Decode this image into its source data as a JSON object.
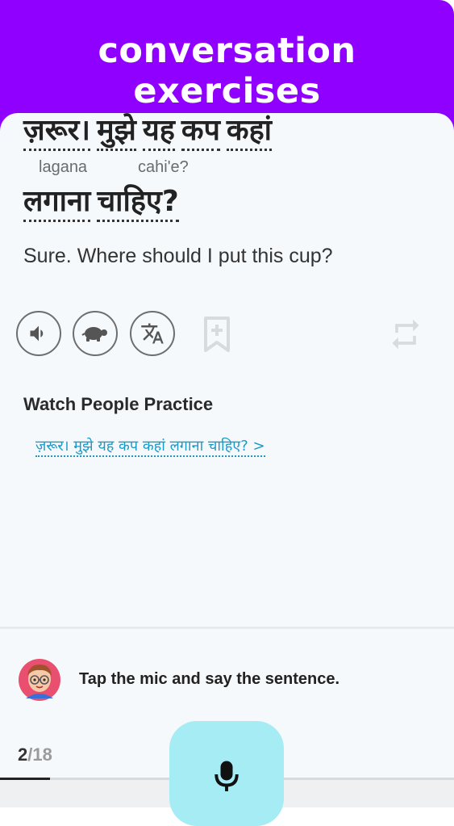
{
  "header": {
    "title": "conversation exercises"
  },
  "sentence": {
    "line1_words": [
      "ज़रूर।",
      "मुझे",
      "यह",
      "कप",
      "कहां"
    ],
    "line2_words": [
      "लगाना",
      "चाहिए?"
    ],
    "romanizations": [
      "lagana",
      "cahi'e?"
    ],
    "translation": "Sure. Where should I put this cup?"
  },
  "controls": {
    "icons": [
      "speaker-icon",
      "turtle-icon",
      "translate-icon",
      "bookmark-add-icon",
      "repeat-icon"
    ]
  },
  "practice": {
    "title": "Watch People Practice",
    "link_text": "ज़रूर। मुझे यह कप कहां लगाना चाहिए? >"
  },
  "feedback": {
    "prompt": "Tap the mic and say the sentence."
  },
  "progress": {
    "current": "2",
    "total": "/18",
    "fraction": 0.111
  },
  "colors": {
    "header": "#9000ff",
    "link": "#1a9ac8",
    "mic": "#a6ecf4"
  }
}
